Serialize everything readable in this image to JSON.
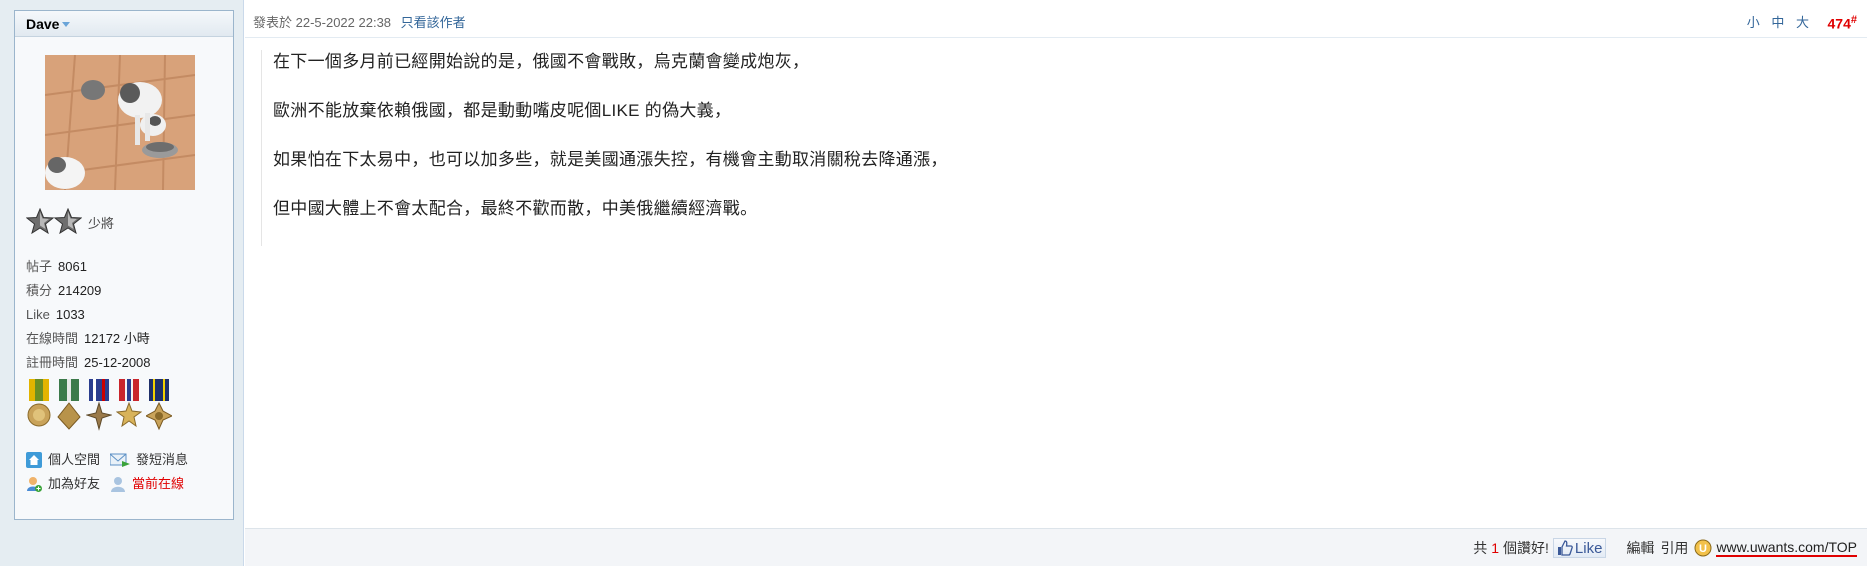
{
  "user": {
    "name": "Dave",
    "rank": "少將",
    "stats": [
      {
        "label": "帖子",
        "value": "8061"
      },
      {
        "label": "積分",
        "value": "214209"
      },
      {
        "label": "Like",
        "value": "1033"
      },
      {
        "label": "在線時間",
        "value": "12172 小時"
      },
      {
        "label": "註冊時間",
        "value": "25-12-2008"
      }
    ],
    "links": {
      "space": "個人空間",
      "message": "發短消息",
      "add_friend": "加為好友",
      "online": "當前在線"
    },
    "star_count": 2,
    "medal_count": 5
  },
  "post": {
    "posted_at": "發表於 22-5-2022 22:38",
    "only_author": "只看該作者",
    "font_sizes": [
      "小",
      "中",
      "大"
    ],
    "floor": "474",
    "floor_suffix": "#",
    "lines": [
      "在下一個多月前已經開始說的是，俄國不會戰敗，烏克蘭會變成炮灰，",
      "歐洲不能放棄依賴俄國，都是動動嘴皮呢個LIKE 的偽大義，",
      "如果怕在下太易中，也可以加多些，就是美國通漲失控，有機會主動取消關稅去降通漲，",
      "但中國大體上不會太配合，最終不歡而散，中美俄繼續經濟戰。"
    ]
  },
  "footer": {
    "like_prefix": "共",
    "like_count": "1",
    "like_suffix": "個讚好!",
    "like_button": "Like",
    "edit": "編輯",
    "quote": "引用",
    "watermark": "www.uwants.com/TOP"
  },
  "colors": {
    "accent_red": "#e00000",
    "link_blue": "#336699",
    "sidebar_bg": "#e5edf2"
  }
}
